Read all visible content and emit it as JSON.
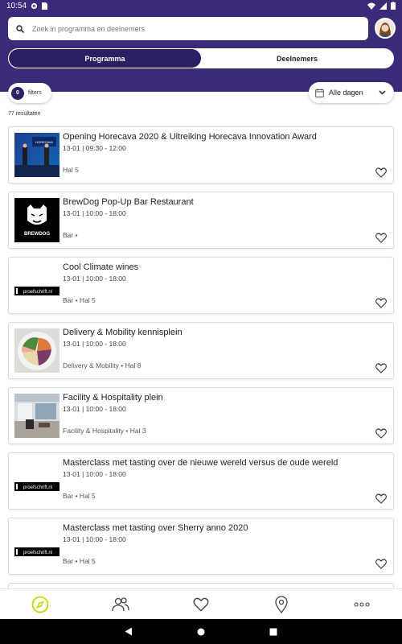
{
  "status": {
    "time": "10:54"
  },
  "search": {
    "placeholder": "Zoek in programma en deelnemers"
  },
  "tabs": [
    {
      "label": "Programma",
      "active": true
    },
    {
      "label": "Deelnemers",
      "active": false
    }
  ],
  "filters": {
    "count": "0",
    "label": "filters"
  },
  "day_select": {
    "value": "Alle dagen"
  },
  "results_label": "77 resultaten",
  "items": [
    {
      "title": "Opening Horecava 2020 & Uitreiking Horecava Innovation Award",
      "time": "13-01 | 09:30 - 12:00",
      "location": "Hal 5",
      "thumb": "stage-photo"
    },
    {
      "title": "BrewDog Pop-Up Bar Restaurant",
      "time": "13-01 | 10:00 - 18:00",
      "location": "Bar •",
      "thumb": "brewdog-logo"
    },
    {
      "title": "Cool Climate wines",
      "time": "13-01 | 10:00 - 18:00",
      "location": "Bar • Hal 5",
      "thumb": "proefschrift-logo"
    },
    {
      "title": "Delivery & Mobility kennisplein",
      "time": "13-01 | 10:00 - 18:00",
      "location": "Delivery & Mobility • Hal 8",
      "thumb": "food-bowl-photo"
    },
    {
      "title": "Facility & Hospitality plein",
      "time": "13-01 | 10:00 - 18:00",
      "location": "Facility & Hospitality • Hal 3",
      "thumb": "lounge-photo"
    },
    {
      "title": "Masterclass met tasting over de nieuwe wereld versus de oude wereld",
      "time": "13-01 | 10:00 - 18:00",
      "location": "Bar • Hal 5",
      "thumb": "proefschrift-logo"
    },
    {
      "title": "Masterclass met tasting over Sherry anno 2020",
      "time": "13-01 | 10:00 - 18:00",
      "location": "Bar • Hal 5",
      "thumb": "proefschrift-logo"
    }
  ],
  "logo_text": {
    "brewdog": "BREWDOG",
    "proefschrift": "proefschrift.nl",
    "horecava": "HORECAVA"
  },
  "bottom_nav": [
    "compass-icon",
    "people-icon",
    "heart-icon",
    "map-pin-icon",
    "more-icon"
  ],
  "colors": {
    "header": "#3a2a78",
    "active_tab": "#2c1f63",
    "accent": "#c8d400"
  }
}
